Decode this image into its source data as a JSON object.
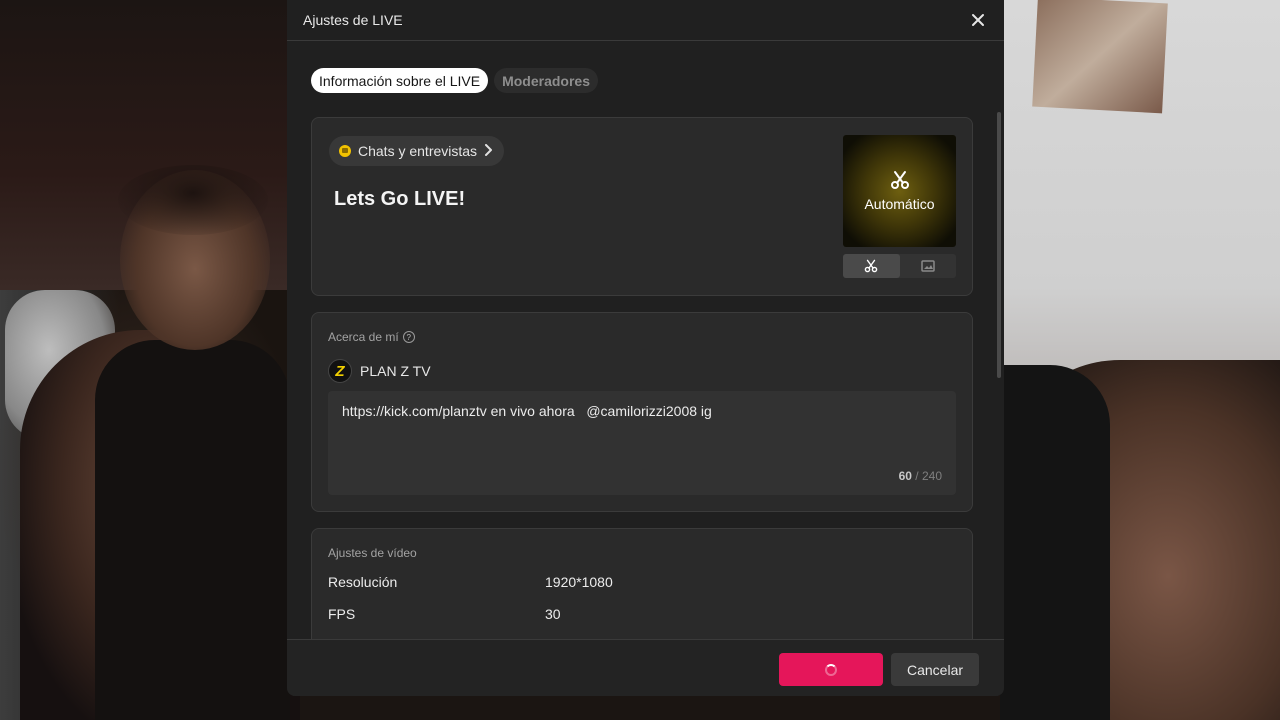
{
  "dialog": {
    "title": "Ajustes de LIVE",
    "close_icon": "close-icon"
  },
  "tabs": [
    {
      "label": "Información sobre el LIVE",
      "active": true
    },
    {
      "label": "Moderadores",
      "active": false
    }
  ],
  "live_info": {
    "category": "Chats y entrevistas",
    "category_icon": "chat-category-icon",
    "title": "Lets Go LIVE!",
    "cover": {
      "label": "Automático",
      "icon": "scissors-icon",
      "toggle_icons": [
        "scissors-icon",
        "image-icon"
      ]
    }
  },
  "about": {
    "label": "Acerca de mí",
    "help_icon": "?",
    "creator_initial": "Z",
    "creator_name": "PLAN Z TV",
    "bio": "https://kick.com/planztv en vivo ahora   @camilorizzi2008 ig",
    "char_count": "60",
    "char_limit": "/ 240"
  },
  "video": {
    "label": "Ajustes de vídeo",
    "rows": [
      {
        "key": "Resolución",
        "value": "1920*1080"
      },
      {
        "key": "FPS",
        "value": "30"
      }
    ]
  },
  "footer": {
    "go_live_state": "loading",
    "cancel_label": "Cancelar"
  },
  "colors": {
    "accent": "#e5165a",
    "dialog_bg": "#202020",
    "card_bg": "#2a2a2a"
  }
}
